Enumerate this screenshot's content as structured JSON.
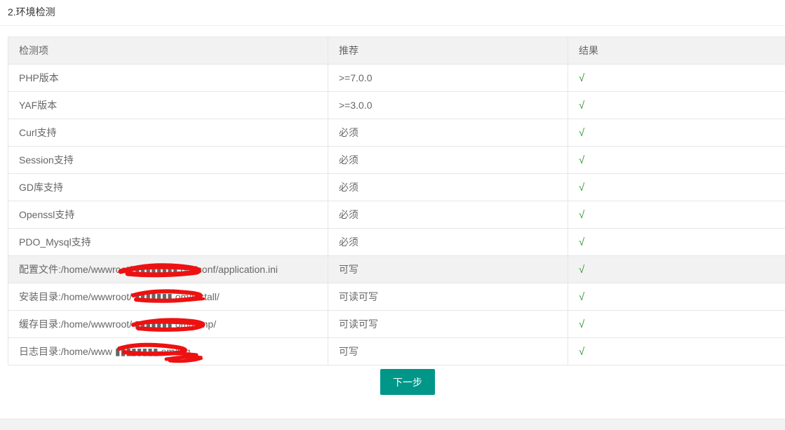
{
  "section_title": "2.环境检测",
  "table": {
    "headers": [
      "检测项",
      "推荐",
      "结果"
    ],
    "rows": [
      {
        "item": "PHP版本",
        "recommended": ">=7.0.0",
        "result": "√"
      },
      {
        "item": "YAF版本",
        "recommended": ">=3.0.0",
        "result": "√"
      },
      {
        "item": "Curl支持",
        "recommended": "必须",
        "result": "√"
      },
      {
        "item": "Session支持",
        "recommended": "必须",
        "result": "√"
      },
      {
        "item": "GD库支持",
        "recommended": "必须",
        "result": "√"
      },
      {
        "item": "Openssl支持",
        "recommended": "必须",
        "result": "√"
      },
      {
        "item": "PDO_Mysql支持",
        "recommended": "必须",
        "result": "√"
      },
      {
        "item": "配置文件:/home/wwwroot/ ▮▮▮▮▮▮▮▮ om/conf/application.ini",
        "recommended": "可写",
        "result": "√"
      },
      {
        "item": "安装目录:/home/wwwroot/ ▮▮▮▮▮▮▮ om/install/",
        "recommended": "可读可写",
        "result": "√"
      },
      {
        "item": "缓存目录:/home/wwwroot/ ▮▮▮▮▮▮▮ om/temp/",
        "recommended": "可读可写",
        "result": "√"
      },
      {
        "item": "日志目录:/home/www ▮▮▮▮▮▮▮▮ om/log",
        "recommended": "可写",
        "result": "√"
      }
    ]
  },
  "next_button": "下一步",
  "colors": {
    "primary": "#009688",
    "check": "#339933",
    "header_bg": "#f2f2f2",
    "redaction": "#ee1111"
  }
}
